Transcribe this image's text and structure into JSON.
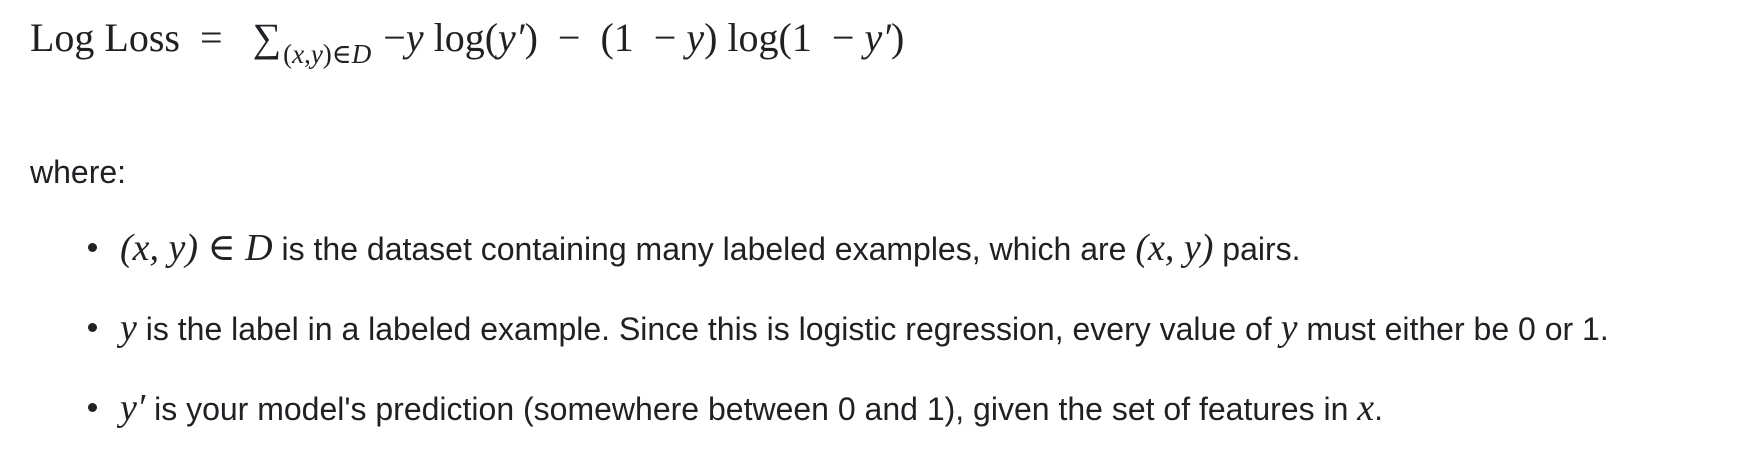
{
  "formula": {
    "lhs": "Log Loss",
    "equals": "=",
    "sum_symbol": "∑",
    "subscript_pre": "(",
    "subscript_x": "x",
    "subscript_comma": ",",
    "subscript_y": "y",
    "subscript_post": ")∈",
    "subscript_D": "D",
    "term1_minus": "−",
    "term1_y": "y",
    "term1_log": "log(",
    "term1_arg": "y′",
    "term1_close": ")",
    "minus": "−",
    "term2_open": "(1",
    "term2_minus": "−",
    "term2_y": "y",
    "term2_close": ")",
    "term2_log": "log(1",
    "term2_minus2": "−",
    "term2_arg": "y′",
    "term2_end": ")"
  },
  "intro": "where:",
  "definitions": [
    {
      "math_a": "(x, y) ∈ D",
      "text_a": " is the dataset containing many labeled examples, which are ",
      "math_b": "(x, y)",
      "text_b": " pairs."
    },
    {
      "math_a": "y",
      "text_a": " is the label in a labeled example. Since this is logistic regression, every value of ",
      "math_b": "y",
      "text_b": " must either be 0 or 1."
    },
    {
      "math_a": "y′",
      "text_a": " is your model's prediction (somewhere between 0 and 1), given the set of features in ",
      "math_b": "x",
      "text_b": "."
    }
  ]
}
